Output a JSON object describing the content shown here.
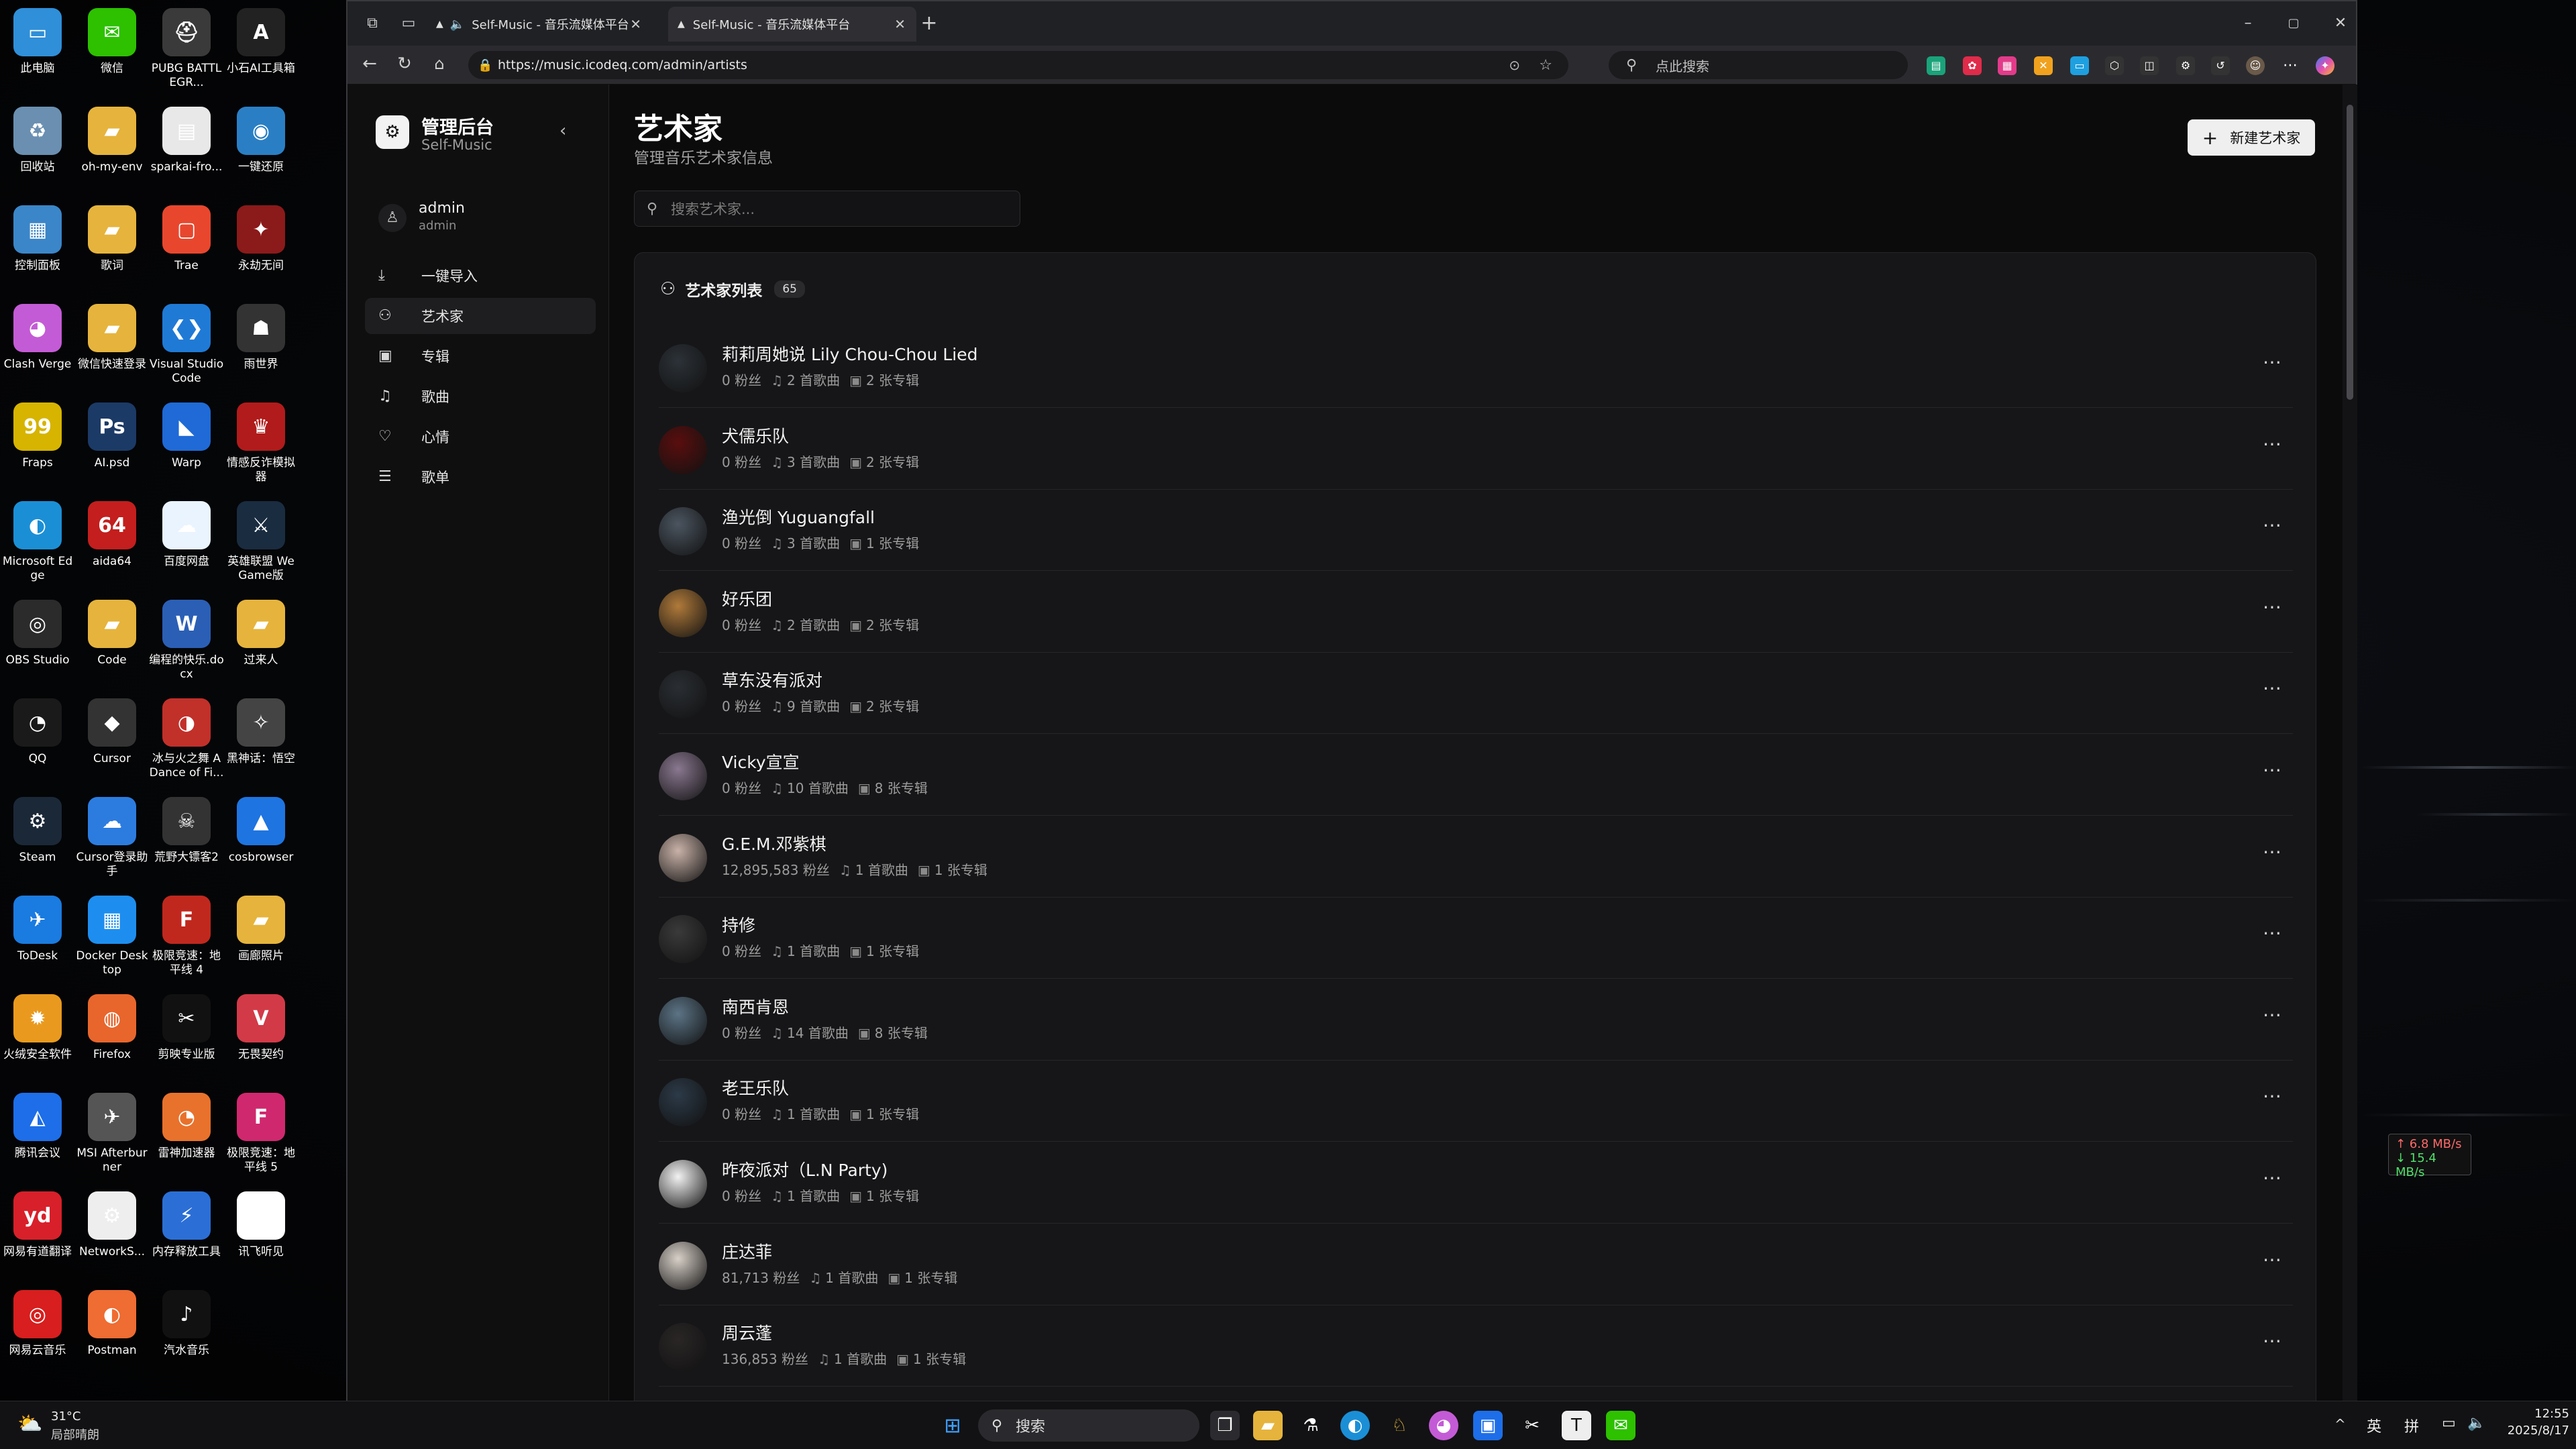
{
  "desktop": {
    "icons": [
      {
        "label": "此电脑",
        "glyph": "▭",
        "color": "#2f8fd8"
      },
      {
        "label": "微信",
        "glyph": "✉",
        "color": "#2dc100"
      },
      {
        "label": "PUBG BATTLEGR...",
        "glyph": "⛑",
        "color": "#3a3a3a"
      },
      {
        "label": "小石AI工具箱",
        "glyph": "A",
        "color": "#222"
      },
      {
        "label": "回收站",
        "glyph": "♻",
        "color": "#6a8fb0"
      },
      {
        "label": "oh-my-env",
        "glyph": "▰",
        "color": "#e6b43c"
      },
      {
        "label": "sparkai-fro...",
        "glyph": "▤",
        "color": "#e8e8e8"
      },
      {
        "label": "一键还原",
        "glyph": "◉",
        "color": "#2a7fc4"
      },
      {
        "label": "控制面板",
        "glyph": "▦",
        "color": "#3b86c8"
      },
      {
        "label": "歌词",
        "glyph": "▰",
        "color": "#e6b43c"
      },
      {
        "label": "Trae",
        "glyph": "▢",
        "color": "#e8472e"
      },
      {
        "label": "永劫无间",
        "glyph": "✦",
        "color": "#8b1a1a"
      },
      {
        "label": "Clash Verge",
        "glyph": "◕",
        "color": "#c45bd6"
      },
      {
        "label": "微信快速登录",
        "glyph": "▰",
        "color": "#e6b43c"
      },
      {
        "label": "Visual Studio Code",
        "glyph": "❮❯",
        "color": "#1f7ad6"
      },
      {
        "label": "雨世界",
        "glyph": "☗",
        "color": "#333"
      },
      {
        "label": "Fraps",
        "glyph": "99",
        "color": "#d6b400"
      },
      {
        "label": "AI.psd",
        "glyph": "Ps",
        "color": "#1c3a66"
      },
      {
        "label": "Warp",
        "glyph": "◣",
        "color": "#1f6ad6"
      },
      {
        "label": "情感反诈模拟器",
        "glyph": "♛",
        "color": "#b11b1b"
      },
      {
        "label": "Microsoft Edge",
        "glyph": "◐",
        "color": "#1b8fd6"
      },
      {
        "label": "aida64",
        "glyph": "64",
        "color": "#c41e1e"
      },
      {
        "label": "百度网盘",
        "glyph": "☁",
        "color": "#e9f4ff"
      },
      {
        "label": "英雄联盟 WeGame版",
        "glyph": "⚔",
        "color": "#1a2c40"
      },
      {
        "label": "OBS Studio",
        "glyph": "◎",
        "color": "#2b2b2b"
      },
      {
        "label": "Code",
        "glyph": "▰",
        "color": "#e6b43c"
      },
      {
        "label": "编程的快乐.docx",
        "glyph": "W",
        "color": "#2b5fb5"
      },
      {
        "label": "过来人",
        "glyph": "▰",
        "color": "#e6b43c"
      },
      {
        "label": "QQ",
        "glyph": "◔",
        "color": "#1a1a1a"
      },
      {
        "label": "Cursor",
        "glyph": "◆",
        "color": "#333"
      },
      {
        "label": "冰与火之舞 A Dance of Fi...",
        "glyph": "◑",
        "color": "#c2302a"
      },
      {
        "label": "黑神话：悟空",
        "glyph": "✧",
        "color": "#444"
      },
      {
        "label": "Steam",
        "glyph": "⚙",
        "color": "#1b2838"
      },
      {
        "label": "Cursor登录助手",
        "glyph": "☁",
        "color": "#2c7ce0"
      },
      {
        "label": "荒野大镖客2",
        "glyph": "☠",
        "color": "#333"
      },
      {
        "label": "cosbrowser",
        "glyph": "▲",
        "color": "#1e74e0"
      },
      {
        "label": "ToDesk",
        "glyph": "✈",
        "color": "#1a7be0"
      },
      {
        "label": "Docker Desktop",
        "glyph": "▦",
        "color": "#1d8ef0"
      },
      {
        "label": "极限竞速：地平线 4",
        "glyph": "F",
        "color": "#c0281e"
      },
      {
        "label": "画廊照片",
        "glyph": "▰",
        "color": "#e6b43c"
      },
      {
        "label": "火绒安全软件",
        "glyph": "✹",
        "color": "#e99a1e"
      },
      {
        "label": "Firefox",
        "glyph": "◍",
        "color": "#e8662c"
      },
      {
        "label": "剪映专业版",
        "glyph": "✂",
        "color": "#111"
      },
      {
        "label": "无畏契约",
        "glyph": "V",
        "color": "#d23a48"
      },
      {
        "label": "腾讯会议",
        "glyph": "◭",
        "color": "#1d6ee8"
      },
      {
        "label": "MSI Afterburner",
        "glyph": "✈",
        "color": "#555"
      },
      {
        "label": "雷神加速器",
        "glyph": "◔",
        "color": "#e8722c"
      },
      {
        "label": "极限竞速：地平线 5",
        "glyph": "F",
        "color": "#d0286e"
      },
      {
        "label": "网易有道翻译",
        "glyph": "yd",
        "color": "#d8202a"
      },
      {
        "label": "NetworkS...",
        "glyph": "⚙",
        "color": "#eee"
      },
      {
        "label": "内存释放工具",
        "glyph": "⚡",
        "color": "#2b6fd6"
      },
      {
        "label": "讯飞听见",
        "glyph": "◖",
        "color": "#fff"
      },
      {
        "label": "网易云音乐",
        "glyph": "◎",
        "color": "#d81e1e"
      },
      {
        "label": "Postman",
        "glyph": "◐",
        "color": "#ef6c32"
      },
      {
        "label": "汽水音乐",
        "glyph": "♪",
        "color": "#111"
      }
    ],
    "weather_temp": "31°C",
    "weather_desc": "局部晴朗"
  },
  "browser": {
    "tabs": [
      {
        "title": "Self-Music - 音乐流媒体平台"
      },
      {
        "title": "Self-Music - 音乐流媒体平台"
      }
    ],
    "url": "https://music.icodeq.com/admin/artists",
    "search_placeholder": "点此搜索"
  },
  "sidebar": {
    "title": "管理后台",
    "subtitle": "Self-Music",
    "user_name": "admin",
    "user_role": "admin",
    "nav": [
      {
        "label": "一键导入",
        "icon": "import-icon",
        "glyph": "⤓"
      },
      {
        "label": "艺术家",
        "icon": "users-icon",
        "glyph": "⚇"
      },
      {
        "label": "专辑",
        "icon": "album-icon",
        "glyph": "▣"
      },
      {
        "label": "歌曲",
        "icon": "music-note-icon",
        "glyph": "♫"
      },
      {
        "label": "心情",
        "icon": "heart-icon",
        "glyph": "♡"
      },
      {
        "label": "歌单",
        "icon": "list-icon",
        "glyph": "☰"
      }
    ],
    "active_index": 1
  },
  "main": {
    "title": "艺术家",
    "subtitle": "管理音乐艺术家信息",
    "new_button": "新建艺术家",
    "search_placeholder": "搜索艺术家...",
    "list_title": "艺术家列表",
    "count": "65"
  },
  "artists": [
    {
      "name": "莉莉周她说 Lily Chou-Chou Lied",
      "fans": "0 粉丝",
      "songs": "2 首歌曲",
      "albums": "2 张专辑",
      "color": "#2c3238"
    },
    {
      "name": "犬儒乐队",
      "fans": "0 粉丝",
      "songs": "3 首歌曲",
      "albums": "2 张专辑",
      "color": "#5a0e0e"
    },
    {
      "name": "渔光倒 Yuguangfall",
      "fans": "0 粉丝",
      "songs": "3 首歌曲",
      "albums": "1 张专辑",
      "color": "#4b5560"
    },
    {
      "name": "好乐团",
      "fans": "0 粉丝",
      "songs": "2 首歌曲",
      "albums": "2 张专辑",
      "color": "#b07a3a"
    },
    {
      "name": "草东没有派对",
      "fans": "0 粉丝",
      "songs": "9 首歌曲",
      "albums": "2 张专辑",
      "color": "#2a2e33"
    },
    {
      "name": "Vicky宣宣",
      "fans": "0 粉丝",
      "songs": "10 首歌曲",
      "albums": "8 张专辑",
      "color": "#8a7890"
    },
    {
      "name": "G.E.M.邓紫棋",
      "fans": "12,895,583 粉丝",
      "songs": "1 首歌曲",
      "albums": "1 张专辑",
      "color": "#c9b2a8"
    },
    {
      "name": "持修",
      "fans": "0 粉丝",
      "songs": "1 首歌曲",
      "albums": "1 张专辑",
      "color": "#3a3a3a"
    },
    {
      "name": "南西肯恩",
      "fans": "0 粉丝",
      "songs": "14 首歌曲",
      "albums": "8 张专辑",
      "color": "#5c7486"
    },
    {
      "name": "老王乐队",
      "fans": "0 粉丝",
      "songs": "1 首歌曲",
      "albums": "1 张专辑",
      "color": "#2c3a48"
    },
    {
      "name": "昨夜派对（L.N Party)",
      "fans": "0 粉丝",
      "songs": "1 首歌曲",
      "albums": "1 张专辑",
      "color": "#f2f2f2"
    },
    {
      "name": "庄达菲",
      "fans": "81,713 粉丝",
      "songs": "1 首歌曲",
      "albums": "1 张专辑",
      "color": "#d8d0c8"
    },
    {
      "name": "周云蓬",
      "fans": "136,853 粉丝",
      "songs": "1 首歌曲",
      "albums": "1 张专辑",
      "color": "#2a2626"
    }
  ],
  "taskbar": {
    "search": "搜索",
    "lang1": "英",
    "lang2": "拼",
    "time": "12:55",
    "date": "2025/8/17"
  },
  "netmon": {
    "up": "↑ 6.8 MB/s",
    "down": "↓ 15.4 MB/s"
  }
}
